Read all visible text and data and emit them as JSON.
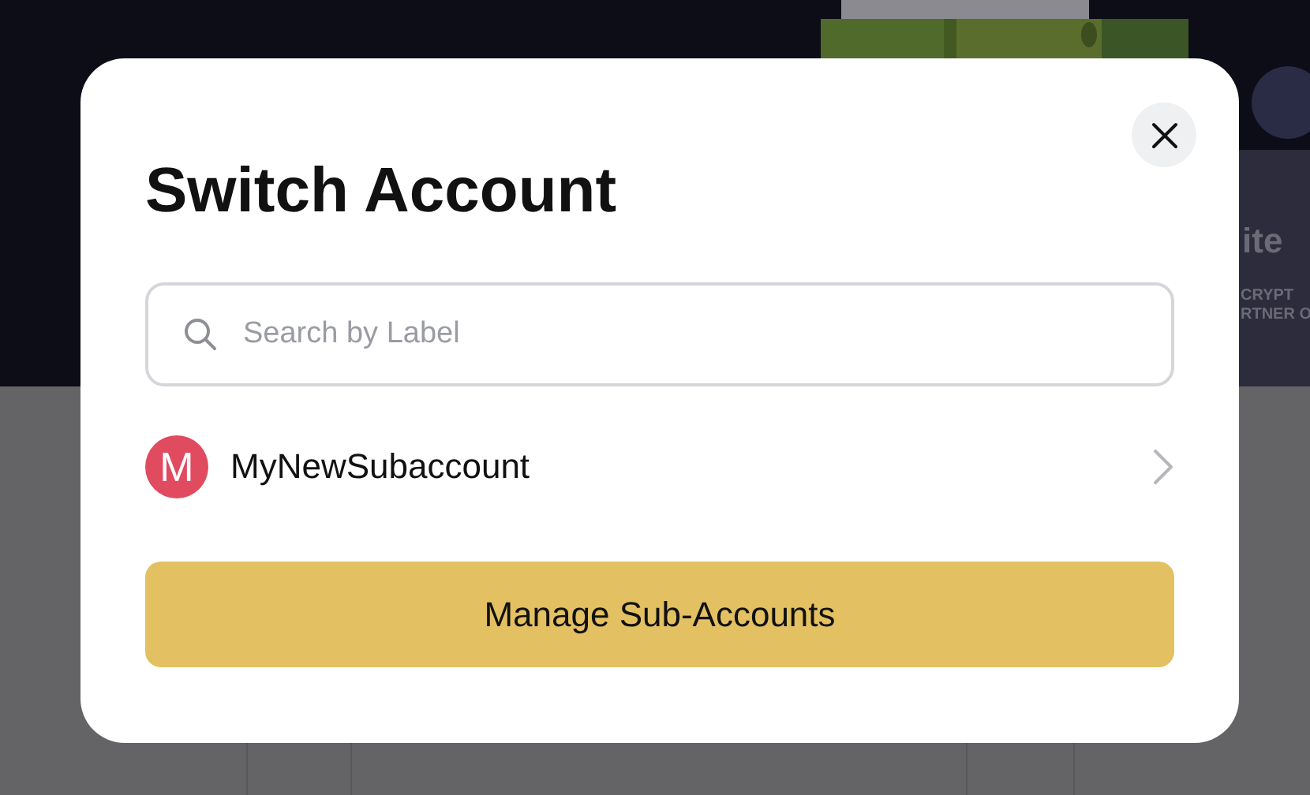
{
  "background": {
    "banner_texts": [
      "ite",
      "CRYPT",
      "RTNER O"
    ]
  },
  "dialog": {
    "title": "Switch Account",
    "search": {
      "placeholder": "Search by Label"
    },
    "accounts": [
      {
        "initial": "M",
        "name": "MyNewSubaccount",
        "color": "#e04b5f"
      }
    ],
    "button": "Manage Sub-Accounts"
  }
}
